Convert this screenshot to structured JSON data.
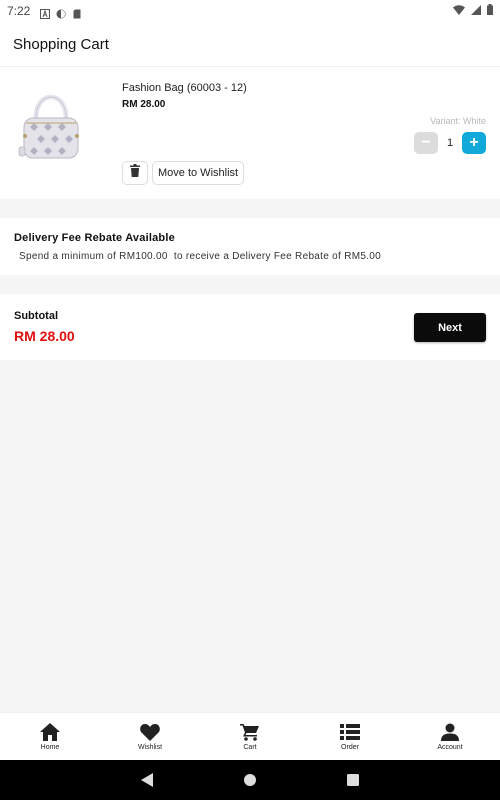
{
  "status_bar": {
    "time": "7:22",
    "icons": [
      "font-icon",
      "vpn-icon",
      "sd-card-icon",
      "wifi-icon",
      "signal-icon",
      "battery-icon"
    ]
  },
  "header": {
    "title": "Shopping Cart"
  },
  "cart": {
    "items": [
      {
        "name": "Fashion Bag (60003 - 12)",
        "price": "RM 28.00",
        "variant": "Variant: White",
        "quantity": "1",
        "minus_label": "−",
        "plus_label": "+",
        "wishlist_label": "Move to Wishlist",
        "image": "handbag-image"
      }
    ]
  },
  "rebate": {
    "title": "Delivery Fee Rebate Available",
    "description": "Spend a minimum of RM100.00  to receive a Delivery Fee Rebate of RM5.00"
  },
  "summary": {
    "subtotal_label": "Subtotal",
    "subtotal_amount": "RM 28.00",
    "next_label": "Next"
  },
  "bottom_nav": {
    "items": [
      {
        "label": "Home",
        "icon": "home-icon"
      },
      {
        "label": "Wishlist",
        "icon": "heart-icon"
      },
      {
        "label": "Cart",
        "icon": "cart-icon"
      },
      {
        "label": "Order",
        "icon": "list-icon"
      },
      {
        "label": "Account",
        "icon": "person-icon"
      }
    ]
  },
  "colors": {
    "accent": "#11a9d9",
    "price_red": "#e01010",
    "button_dark": "#0b0b0b",
    "background": "#f5f5f5"
  }
}
